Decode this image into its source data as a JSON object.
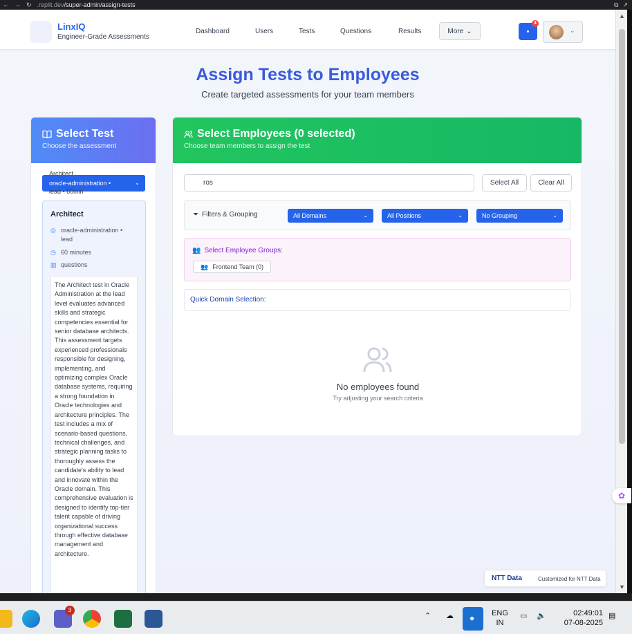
{
  "browser": {
    "url_domain": ".replit.dev",
    "url_path": "/super-admin/assign-tests"
  },
  "navbar": {
    "brand_name": "LinxIQ",
    "brand_tagline": "Engineer-Grade Assessments",
    "links": [
      "Dashboard",
      "Users",
      "Tests",
      "Questions",
      "Results"
    ],
    "more_label": "More",
    "notification_count": "4"
  },
  "header": {
    "title": "Assign Tests to Employees",
    "subtitle": "Create targeted assessments for your team members"
  },
  "select_test": {
    "title": "Select Test",
    "subtitle": "Choose the assessment",
    "dropdown_line1": "Architect",
    "dropdown_line2": "oracle-administration •",
    "dropdown_line3": "lead • 60min",
    "selected": {
      "name": "Architect",
      "domain_level": "oracle-administration • lead",
      "duration": "60 minutes",
      "questions": "questions",
      "description": "The Architect test in Oracle Administration at the lead level evaluates advanced skills and strategic competencies essential for senior database architects. This assessment targets experienced professionals responsible for designing, implementing, and optimizing complex Oracle database systems, requiring a strong foundation in Oracle technologies and architecture principles. The test includes a mix of scenario-based questions, technical challenges, and strategic planning tasks to thoroughly assess the candidate's ability to lead and innovate within the Oracle domain. This comprehensive evaluation is designed to identify top-tier talent capable of driving organizational success through effective database management and architecture."
    }
  },
  "select_employees": {
    "title": "Select Employees (0 selected)",
    "subtitle": "Choose team members to assign the test",
    "search_value": "ros",
    "select_all_label": "Select All",
    "clear_all_label": "Clear All",
    "filters_label": "Filters & Grouping",
    "domain_filter": "All Domains",
    "position_filter": "All Positions",
    "grouping_filter": "No Grouping",
    "groups_label": "Select Employee Groups:",
    "groups": [
      "Frontend Team (0)"
    ],
    "quick_domain_label": "Quick Domain Selection:",
    "empty_title": "No employees found",
    "empty_subtitle": "Try adjusting your search criteria"
  },
  "footer_badge": {
    "logo": "NTT Data",
    "text": "Customized for NTT Data"
  },
  "taskbar": {
    "teams_badge": "3",
    "lang_line1": "ENG",
    "lang_line2": "IN",
    "time": "02:49:01",
    "date": "07-08-2025"
  },
  "colors": {
    "primary_blue": "#2563eb",
    "title_blue": "#3b5bdb",
    "green_header": "#22c55e",
    "purple_groups": "#7e22ce"
  }
}
